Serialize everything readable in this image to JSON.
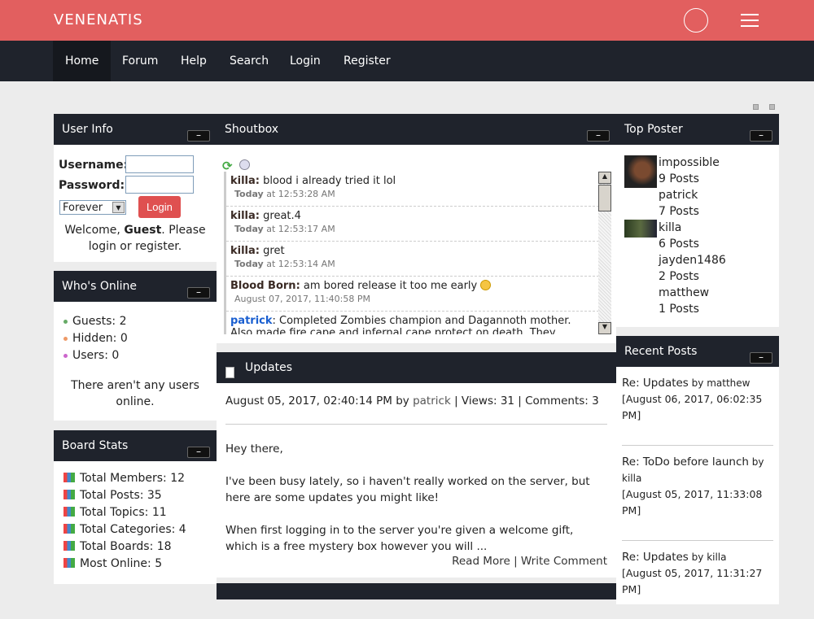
{
  "header": {
    "brand": "VENENATIS"
  },
  "nav": [
    "Home",
    "Forum",
    "Help",
    "Search",
    "Login",
    "Register"
  ],
  "user_info": {
    "title": "User Info",
    "username_label": "Username:",
    "password_label": "Password:",
    "duration": "Forever",
    "login_button": "Login",
    "welcome_prefix": "Welcome, ",
    "guest": "Guest",
    "welcome_suffix": ". Please login or register."
  },
  "whos_online": {
    "title": "Who's Online",
    "items": [
      "Guests: 2",
      "Hidden: 0",
      "Users: 0"
    ],
    "dot_colors": [
      "#6a6",
      "#e96",
      "#c6c"
    ],
    "note": "There aren't any users online."
  },
  "board_stats": {
    "title": "Board Stats",
    "items": [
      "Total Members: 12",
      "Total Posts: 35",
      "Total Topics: 11",
      "Total Categories: 4",
      "Total Boards: 18",
      "Most Online: 5"
    ]
  },
  "shoutbox": {
    "title": "Shoutbox",
    "messages": [
      {
        "user": "killa:",
        "text": " blood i already tried it lol",
        "day": "Today",
        "time": " at 12:53:28 AM"
      },
      {
        "user": "killa:",
        "text": " great.4",
        "day": "Today",
        "time": " at 12:53:17 AM"
      },
      {
        "user": "killa:",
        "text": " gret",
        "day": "Today",
        "time": " at 12:53:14 AM"
      },
      {
        "user": "Blood Born:",
        "text": " am bored release it too me early",
        "day": "",
        "time": "August 07, 2017, 11:40:58 PM"
      },
      {
        "user": "patrick",
        "text": ": Completed Zombies champion and Dagannoth mother. Also made fire cape and infernal cape protect on death. They spawn in your",
        "day": "",
        "time": ""
      }
    ]
  },
  "updates": {
    "title": "Updates",
    "date": "August 05, 2017, 02:40:14 PM by ",
    "author": "patrick",
    "meta": " | Views: 31 | Comments: 3",
    "p1": "Hey there,",
    "p2": "I've been busy lately, so i haven't really worked on the server, but here are some updates you might like!",
    "p3": "When first logging in to the server you're given a welcome gift, which is a free mystery box however you will ...",
    "read_more": "Read More",
    "write_comment": "Write Comment"
  },
  "top_poster": {
    "title": "Top Poster",
    "posters": [
      {
        "name": "impossible",
        "posts": "9 Posts"
      },
      {
        "name": "patrick",
        "posts": "7 Posts"
      },
      {
        "name": "killa",
        "posts": "6 Posts"
      },
      {
        "name": "jayden1486",
        "posts": "2 Posts"
      },
      {
        "name": "matthew",
        "posts": "1 Posts"
      }
    ]
  },
  "recent_posts": {
    "title": "Recent Posts",
    "items": [
      {
        "topic": "Re: Updates",
        "by": " by matthew",
        "date": "[August 06, 2017, 06:02:35 PM]"
      },
      {
        "topic": "Re: ToDo before launch",
        "by": " by killa",
        "date": "[August 05, 2017, 11:33:08 PM]"
      },
      {
        "topic": "Re: Updates",
        "by": " by killa",
        "date": "[August 05, 2017, 11:31:27 PM]"
      }
    ]
  },
  "colors": {
    "header": "#e25f5f",
    "nav": "#1f232c",
    "login_button": "#df5050",
    "patrick": "#1a5fd0"
  }
}
